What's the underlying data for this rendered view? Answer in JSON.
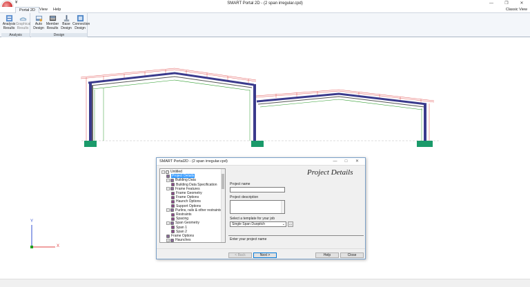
{
  "window": {
    "title": "SMART Portal 2D - (2 span irregular.cpd)",
    "qat_label": "¥",
    "controls": {
      "minimize": "—",
      "maximize": "❐",
      "close": "✕"
    }
  },
  "ribbon": {
    "tabs": [
      {
        "label": "Portal 2D"
      },
      {
        "label": "View"
      },
      {
        "label": "Help"
      }
    ],
    "classic_view": "Classic View",
    "groups": {
      "analysis": {
        "label": "Analysis",
        "buttons": [
          {
            "label_line1": "Analysis",
            "label_line2": "Results",
            "icon": "analysis-results-icon",
            "enabled": true
          },
          {
            "label_line1": "Graphical",
            "label_line2": "Results",
            "icon": "graphical-results-icon",
            "enabled": false
          }
        ]
      },
      "design": {
        "label": "Design",
        "buttons": [
          {
            "label_line1": "Auto",
            "label_line2": "Design",
            "icon": "auto-design-icon"
          },
          {
            "label_line1": "Member",
            "label_line2": "Results",
            "icon": "member-results-icon"
          },
          {
            "label_line1": "Base",
            "label_line2": "Design",
            "icon": "base-design-icon"
          },
          {
            "label_line1": "Connection",
            "label_line2": "Design",
            "icon": "connection-design-icon"
          }
        ]
      }
    }
  },
  "axis": {
    "y": "Y",
    "x": "X"
  },
  "dialog": {
    "title": "SMART Portal2D - (2 span irregular.cpd)",
    "controls": {
      "minimize": "—",
      "maximize": "□",
      "close": "✕"
    },
    "heading": "Project Details",
    "tree": [
      {
        "label": "Untitled",
        "level": 0,
        "expander": "−"
      },
      {
        "label": "Project Details",
        "level": 1,
        "selected": true
      },
      {
        "label": "Building Data",
        "level": 1,
        "expander": "−"
      },
      {
        "label": "Building Data Specification",
        "level": 2
      },
      {
        "label": "Frame Features",
        "level": 1,
        "expander": "−"
      },
      {
        "label": "Frame Geometry",
        "level": 2
      },
      {
        "label": "Frame Options",
        "level": 2
      },
      {
        "label": "Haunch Options",
        "level": 2
      },
      {
        "label": "Support Options",
        "level": 2
      },
      {
        "label": "Purlins, rails & other restraints",
        "level": 1,
        "expander": "−"
      },
      {
        "label": "Restraints",
        "level": 2
      },
      {
        "label": "Spacing",
        "level": 2
      },
      {
        "label": "Span Geometry",
        "level": 1,
        "expander": "−"
      },
      {
        "label": "Span 1",
        "level": 2
      },
      {
        "label": "Span 2",
        "level": 2
      },
      {
        "label": "Frame Options",
        "level": 1
      },
      {
        "label": "Haunches",
        "level": 1,
        "expander": "+"
      }
    ],
    "fields": {
      "project_name_label": "Project name",
      "project_name_value": "",
      "project_description_label": "Project description",
      "project_description_value": "",
      "template_label": "Select a template for your job",
      "template_value": "Single Span Duopitch",
      "browse": "..."
    },
    "hint": "Enter your project name",
    "buttons": {
      "back": "< Back",
      "next": "Next >",
      "help": "Help",
      "close": "Close"
    }
  },
  "colors": {
    "frame": "#3a3a8c",
    "support": "#1a9a6a",
    "restraint": "#e05050",
    "inner": "#2a9a2a",
    "axis_y": "#3050d0",
    "axis_x": "#e04040",
    "axis_origin": "#20a020"
  }
}
